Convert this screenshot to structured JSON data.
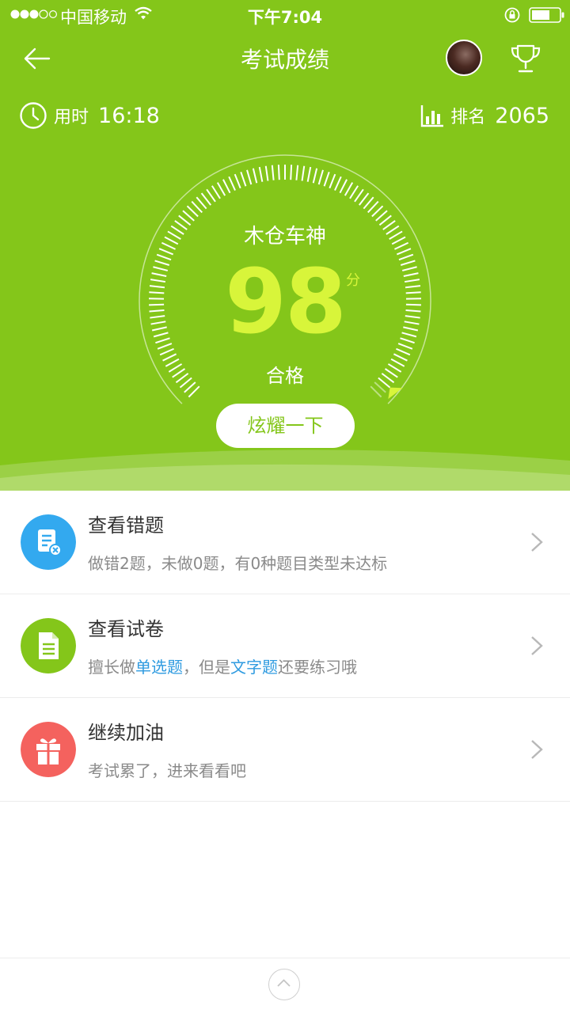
{
  "status_bar": {
    "carrier": "中国移动",
    "time": "下午7:04",
    "signal_icon": "signal-dots-icon",
    "wifi_icon": "wifi-icon",
    "lock_icon": "rotation-lock-icon",
    "battery_icon": "battery-icon"
  },
  "nav": {
    "title": "考试成绩",
    "back_icon": "back-arrow-icon",
    "avatar_icon": "user-avatar",
    "trophy_icon": "trophy-icon"
  },
  "stats": {
    "time_label": "用时",
    "time_value": "16:18",
    "rank_label": "排名",
    "rank_value": "2065"
  },
  "score": {
    "name": "木仓车神",
    "value": "98",
    "unit": "分",
    "status": "合格",
    "level": 98,
    "max": 100
  },
  "share_button": "炫耀一下",
  "list": [
    {
      "title": "查看错题",
      "subtitle": "做错2题，未做0题，有0种题目类型未达标",
      "icon": "wrong-questions-icon"
    },
    {
      "title": "查看试卷",
      "subtitle_parts": [
        "擅长做",
        "单选题",
        "，但是",
        "文字题",
        "还要练习哦"
      ],
      "icon": "exam-paper-icon"
    },
    {
      "title": "继续加油",
      "subtitle": "考试累了，进来看看吧",
      "icon": "gift-icon"
    }
  ],
  "colors": {
    "hero": "#84c61a",
    "score": "#d8f53a",
    "row1_icon": "#33a9ef",
    "row2_icon": "#84c61a",
    "row3_icon": "#f4625e",
    "highlight": "#2f9be0"
  },
  "footer": {
    "up_icon": "chevron-up-icon"
  }
}
